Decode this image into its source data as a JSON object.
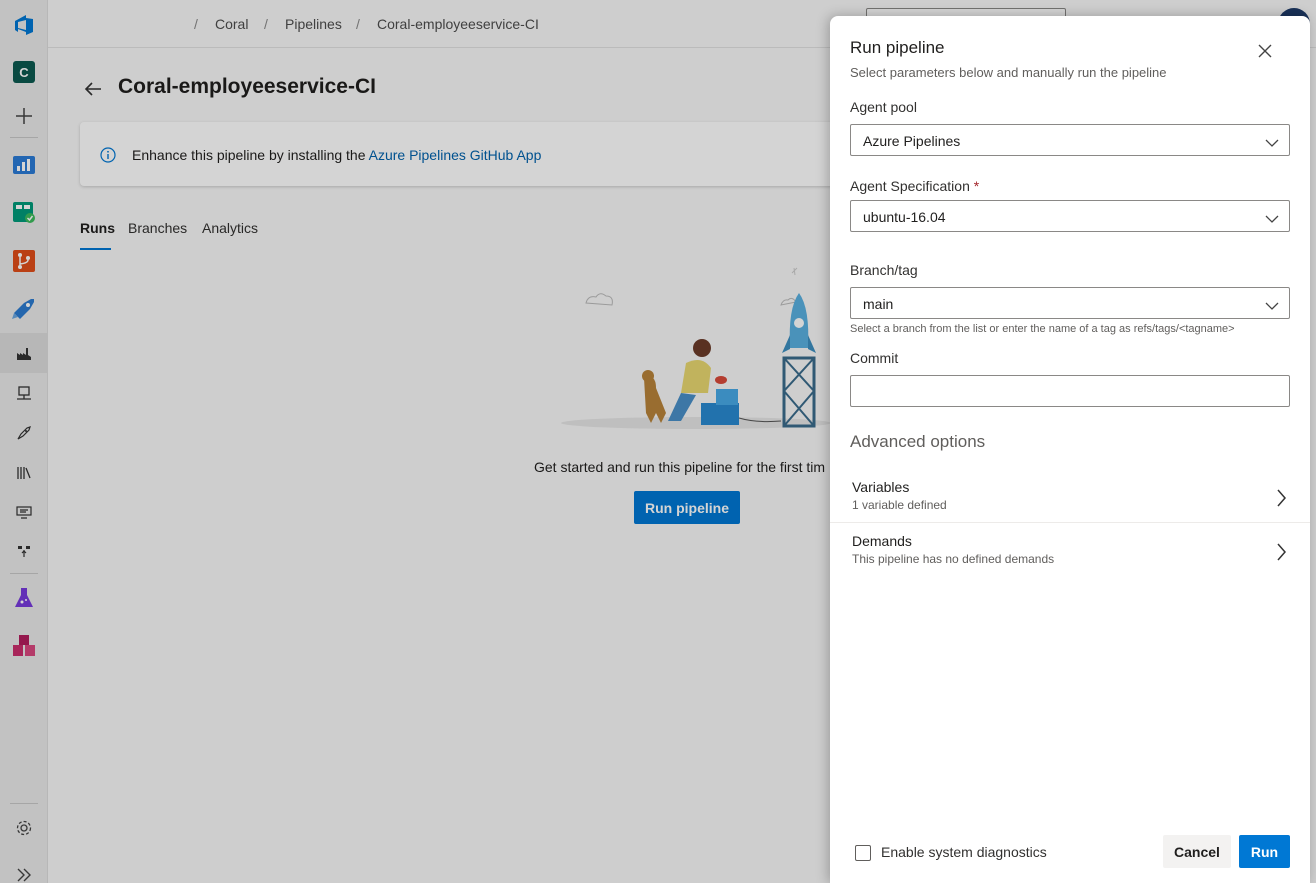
{
  "breadcrumb": {
    "items": [
      "Coral",
      "Pipelines",
      "Coral-employeeservice-CI"
    ],
    "separator": "/"
  },
  "rail": {
    "org_initial": "C"
  },
  "page": {
    "title": "Coral-employeeservice-CI",
    "banner_text": "Enhance this pipeline by installing the ",
    "banner_link": "Azure Pipelines GitHub App",
    "tabs": [
      "Runs",
      "Branches",
      "Analytics"
    ],
    "active_tab": "Runs",
    "empty_text": "Get started and run this pipeline for the first tim",
    "run_button": "Run pipeline"
  },
  "panel": {
    "title": "Run pipeline",
    "subtitle": "Select parameters below and manually run the pipeline",
    "agent_pool_label": "Agent pool",
    "agent_pool_value": "Azure Pipelines",
    "agent_spec_label": "Agent Specification",
    "agent_spec_required": "*",
    "agent_spec_value": "ubuntu-16.04",
    "branch_label": "Branch/tag",
    "branch_value": "main",
    "branch_hint": "Select a branch from the list or enter the name of a tag as refs/tags/<tagname>",
    "commit_label": "Commit",
    "commit_value": "",
    "advanced_heading": "Advanced options",
    "variables_title": "Variables",
    "variables_sub": "1 variable defined",
    "demands_title": "Demands",
    "demands_sub": "This pipeline has no defined demands",
    "diagnostics_label": "Enable system diagnostics",
    "diagnostics_checked": false,
    "cancel_label": "Cancel",
    "run_label": "Run"
  },
  "colors": {
    "accent": "#0078d4",
    "link": "#0062ad",
    "required": "#a4262c"
  }
}
